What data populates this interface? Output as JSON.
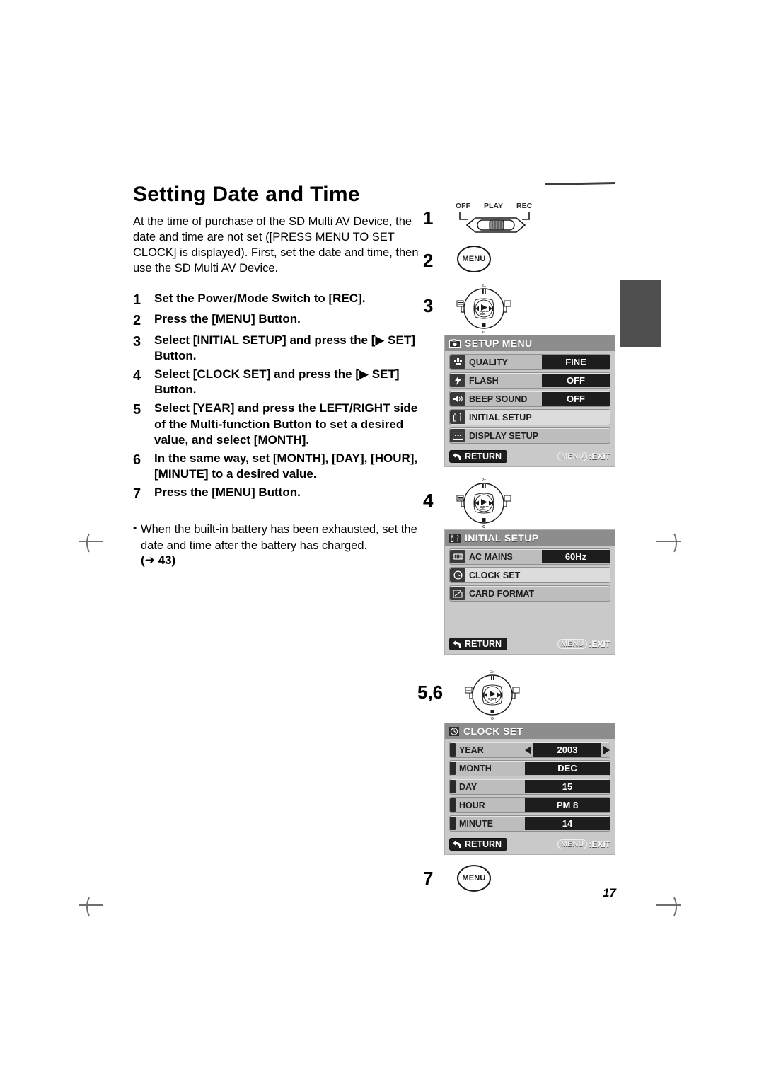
{
  "document": {
    "title": "Setting Date and Time",
    "intro": "At the time of purchase of the SD Multi AV Device, the date and time are not set ([PRESS MENU TO SET CLOCK] is displayed). First, set the date and time, then use the SD Multi AV Device.",
    "page_number": "17"
  },
  "steps": [
    {
      "num": "1",
      "text": "Set the Power/Mode Switch to [REC]."
    },
    {
      "num": "2",
      "text": "Press the [MENU] Button."
    },
    {
      "num": "3",
      "text": "Select [INITIAL SETUP] and press the [▶ SET] Button."
    },
    {
      "num": "4",
      "text": "Select [CLOCK SET] and press the [▶ SET] Button."
    },
    {
      "num": "5",
      "text": "Select [YEAR] and press the LEFT/RIGHT side of the Multi-function Button to set a desired value, and select [MONTH]."
    },
    {
      "num": "6",
      "text": "In the same way, set [MONTH], [DAY], [HOUR], [MINUTE] to a desired value."
    },
    {
      "num": "7",
      "text": "Press the [MENU] Button."
    }
  ],
  "note": {
    "bullet": "•",
    "text": "When the built-in battery has been exhausted, set the date and time after the battery has charged.",
    "reference": "(➜ 43)"
  },
  "illustrations": {
    "step1": {
      "num": "1",
      "switch_labels": [
        "OFF",
        "PLAY",
        "REC"
      ]
    },
    "step2": {
      "num": "2",
      "button_label": "MENU"
    },
    "step3": {
      "num": "3",
      "dial_center_label": "SET"
    },
    "step4": {
      "num": "4",
      "dial_center_label": "SET"
    },
    "step56": {
      "num": "5,6",
      "dial_center_label": "SET"
    },
    "step7": {
      "num": "7",
      "button_label": "MENU"
    }
  },
  "screens": {
    "setup_menu": {
      "title": "SETUP MENU",
      "icon": "camera-icon",
      "rows": [
        {
          "icon": "quality-icon",
          "label": "QUALITY",
          "value": "FINE",
          "selected": false
        },
        {
          "icon": "flash-icon",
          "label": "FLASH",
          "value": "OFF",
          "selected": false
        },
        {
          "icon": "beep-icon",
          "label": "BEEP SOUND",
          "value": "OFF",
          "selected": false
        },
        {
          "icon": "tools-icon",
          "label": "INITIAL SETUP",
          "value": "",
          "selected": true
        },
        {
          "icon": "display-icon",
          "label": "DISPLAY SETUP",
          "value": "",
          "selected": false
        }
      ],
      "return_label": "RETURN",
      "exit_key": "MENU",
      "exit_label": ":EXIT"
    },
    "initial_setup": {
      "title": "INITIAL SETUP",
      "icon": "tools-icon",
      "rows": [
        {
          "icon": "ac-mains-icon",
          "label": "AC MAINS",
          "value": "60Hz",
          "selected": false
        },
        {
          "icon": "clock-icon",
          "label": "CLOCK SET",
          "value": "",
          "selected": true
        },
        {
          "icon": "card-format-icon",
          "label": "CARD FORMAT",
          "value": "",
          "selected": false
        }
      ],
      "return_label": "RETURN",
      "exit_key": "MENU",
      "exit_label": ":EXIT"
    },
    "clock_set": {
      "title": "CLOCK SET",
      "icon": "clock-icon",
      "rows": [
        {
          "label": "YEAR",
          "value": "2003",
          "arrows": true
        },
        {
          "label": "MONTH",
          "value": "DEC",
          "arrows": false
        },
        {
          "label": "DAY",
          "value": "15",
          "arrows": false
        },
        {
          "label": "HOUR",
          "value": "PM 8",
          "arrows": false
        },
        {
          "label": "MINUTE",
          "value": "14",
          "arrows": false
        }
      ],
      "return_label": "RETURN",
      "exit_key": "MENU",
      "exit_label": ":EXIT"
    }
  },
  "colors": {
    "screen_bg": "#c9c9c9",
    "screen_header": "#8d8d8d",
    "row_bg": "#bdbdbd",
    "row_selected_bg": "#dcdcdc",
    "value_bg": "#1d1d1d",
    "tab_mark": "#4f4f4f"
  }
}
